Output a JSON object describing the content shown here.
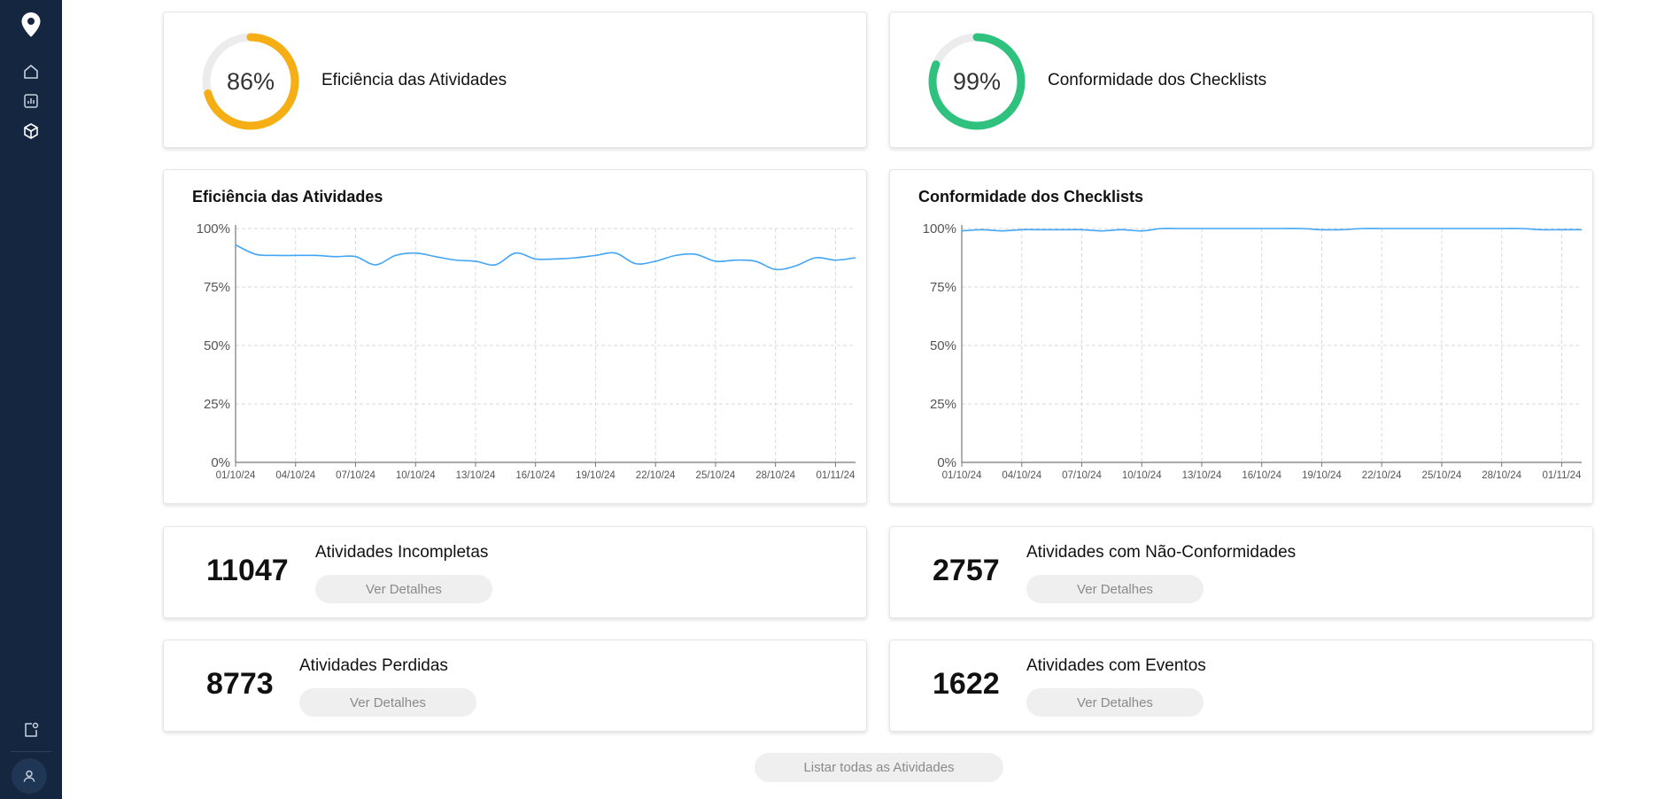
{
  "sidebar": {
    "logo_icon": "map-pin-icon",
    "nav": [
      {
        "icon": "home-icon"
      },
      {
        "icon": "bar-chart-icon"
      },
      {
        "icon": "cube-icon",
        "active": true
      }
    ],
    "bottom": [
      {
        "icon": "notification-icon"
      },
      {
        "icon": "user-icon"
      }
    ],
    "colors": {
      "background": "#142640",
      "icon": "#c9d3e0"
    }
  },
  "gauges": [
    {
      "percent": "86%",
      "value": 0.86,
      "label": "Eficiência das Atividades",
      "color": "#f5ae14"
    },
    {
      "percent": "99%",
      "value": 0.99,
      "label": "Conformidade dos Checklists",
      "color": "#2ec27e"
    }
  ],
  "chart_data": [
    {
      "type": "line",
      "title": "Eficiência das Atividades",
      "xlabel": "",
      "ylabel": "",
      "ylim": [
        0,
        100
      ],
      "yticks": [
        "100%",
        "75%",
        "50%",
        "25%",
        "0%"
      ],
      "xticks": [
        "01/10/24",
        "04/10/24",
        "07/10/24",
        "10/10/24",
        "13/10/24",
        "16/10/24",
        "19/10/24",
        "22/10/24",
        "25/10/24",
        "28/10/24",
        "01/11/24"
      ],
      "grid": true,
      "color": "#42a5f5",
      "x": [
        "2024-10-01",
        "2024-10-02",
        "2024-10-03",
        "2024-10-04",
        "2024-10-05",
        "2024-10-06",
        "2024-10-07",
        "2024-10-08",
        "2024-10-09",
        "2024-10-10",
        "2024-10-11",
        "2024-10-12",
        "2024-10-13",
        "2024-10-14",
        "2024-10-15",
        "2024-10-16",
        "2024-10-17",
        "2024-10-18",
        "2024-10-19",
        "2024-10-20",
        "2024-10-21",
        "2024-10-22",
        "2024-10-23",
        "2024-10-24",
        "2024-10-25",
        "2024-10-26",
        "2024-10-27",
        "2024-10-28",
        "2024-10-29",
        "2024-10-30",
        "2024-10-31",
        "2024-11-01"
      ],
      "values": [
        93,
        89,
        88.5,
        88.5,
        88.5,
        88,
        88,
        84.5,
        88.5,
        89.5,
        88,
        86.5,
        86,
        84.5,
        89.5,
        87,
        87,
        87.5,
        88.5,
        89.5,
        85,
        86,
        88.5,
        89,
        86,
        86.5,
        86,
        82.5,
        84,
        87.5,
        86.5,
        87.5
      ]
    },
    {
      "type": "line",
      "title": "Conformidade dos Checklists",
      "xlabel": "",
      "ylabel": "",
      "ylim": [
        0,
        100
      ],
      "yticks": [
        "100%",
        "75%",
        "50%",
        "25%",
        "0%"
      ],
      "xticks": [
        "01/10/24",
        "04/10/24",
        "07/10/24",
        "10/10/24",
        "13/10/24",
        "16/10/24",
        "19/10/24",
        "22/10/24",
        "25/10/24",
        "28/10/24",
        "01/11/24"
      ],
      "grid": true,
      "color": "#42a5f5",
      "x": [
        "2024-10-01",
        "2024-10-02",
        "2024-10-03",
        "2024-10-04",
        "2024-10-05",
        "2024-10-06",
        "2024-10-07",
        "2024-10-08",
        "2024-10-09",
        "2024-10-10",
        "2024-10-11",
        "2024-10-12",
        "2024-10-13",
        "2024-10-14",
        "2024-10-15",
        "2024-10-16",
        "2024-10-17",
        "2024-10-18",
        "2024-10-19",
        "2024-10-20",
        "2024-10-21",
        "2024-10-22",
        "2024-10-23",
        "2024-10-24",
        "2024-10-25",
        "2024-10-26",
        "2024-10-27",
        "2024-10-28",
        "2024-10-29",
        "2024-10-30",
        "2024-10-31",
        "2024-11-01"
      ],
      "values": [
        99,
        99.5,
        99,
        99.5,
        99.5,
        99.5,
        99.5,
        99,
        99.5,
        99,
        100,
        100,
        100,
        100,
        100,
        100,
        100,
        100,
        99.5,
        99.5,
        100,
        100,
        100,
        100,
        100,
        100,
        100,
        100,
        100,
        99.5,
        99.5,
        99.5
      ]
    }
  ],
  "stats": [
    {
      "number": "11047",
      "label": "Atividades Incompletas",
      "button": "Ver Detalhes"
    },
    {
      "number": "2757",
      "label": "Atividades com Não-Conformidades",
      "button": "Ver Detalhes"
    },
    {
      "number": "8773",
      "label": "Atividades Perdidas",
      "button": "Ver Detalhes"
    },
    {
      "number": "1622",
      "label": "Atividades com Eventos",
      "button": "Ver Detalhes"
    }
  ],
  "footer": {
    "list_all_label": "Listar todas as Atividades"
  }
}
